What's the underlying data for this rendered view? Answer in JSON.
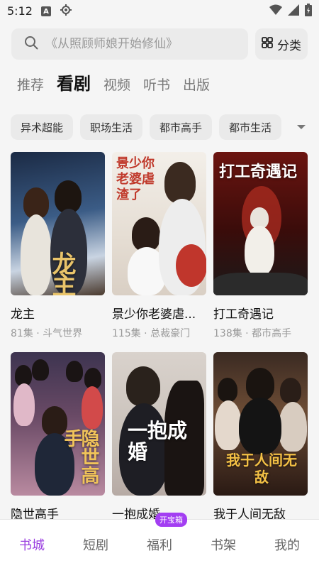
{
  "status_bar": {
    "time": "5:12",
    "notification_letter": "A"
  },
  "search": {
    "placeholder": "《从照顾师娘开始修仙》"
  },
  "category_button": {
    "label": "分类"
  },
  "tabs": [
    {
      "label": "推荐",
      "active": false
    },
    {
      "label": "看剧",
      "active": true
    },
    {
      "label": "视频",
      "active": false
    },
    {
      "label": "听书",
      "active": false
    },
    {
      "label": "出版",
      "active": false
    }
  ],
  "chips": [
    "异术超能",
    "职场生活",
    "都市高手",
    "都市生活"
  ],
  "cards": [
    {
      "title": "龙主",
      "meta": "81集 · 斗气世界",
      "poster_text": "龙主"
    },
    {
      "title": "景少你老婆虐...",
      "meta": "115集 · 总裁豪门",
      "poster_text": "景少你老婆虐渣了"
    },
    {
      "title": "打工奇遇记",
      "meta": "138集 · 都市高手",
      "poster_text": "打工奇遇记"
    },
    {
      "title": "隐世高手",
      "meta": "",
      "poster_text": "隐世高手"
    },
    {
      "title": "一抱成婚",
      "meta": "",
      "poster_text": "一抱成婚"
    },
    {
      "title": "我于人间无敌",
      "meta": "",
      "poster_text": "我于人间无敌"
    }
  ],
  "bottom_nav": {
    "items": [
      {
        "label": "书城",
        "active": true
      },
      {
        "label": "短剧",
        "active": false
      },
      {
        "label": "福利",
        "active": false,
        "badge": "开宝箱"
      },
      {
        "label": "书架",
        "active": false
      },
      {
        "label": "我的",
        "active": false
      }
    ]
  },
  "colors": {
    "accent": "#9b3fe0",
    "badge": "#a33ef2"
  }
}
